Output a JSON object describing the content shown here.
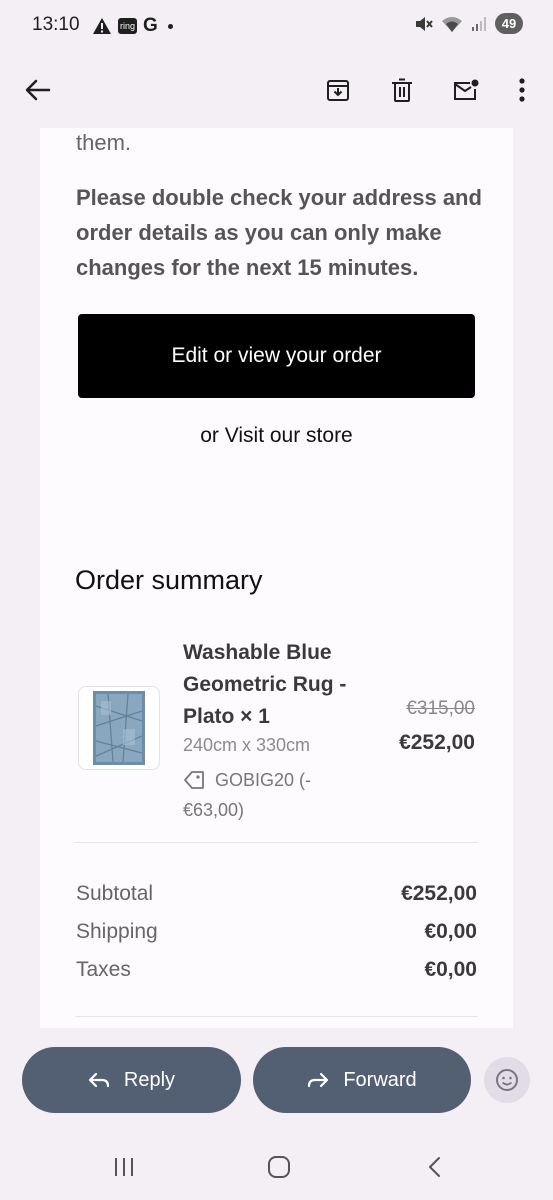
{
  "status_bar": {
    "time": "13:10",
    "notif_ring": "ring",
    "notif_g": "G",
    "battery": "49"
  },
  "app_bar": {
    "icons": [
      "back-arrow-icon",
      "archive-icon",
      "delete-icon",
      "mark-unread-icon",
      "more-vert-icon"
    ]
  },
  "email": {
    "partial_text": "them.",
    "notice": "Please double check your address and order details as you can only make changes for the next 15 minutes.",
    "primary_button": "Edit or view your order",
    "secondary_link": "or Visit our store",
    "summary_title": "Order summary",
    "product": {
      "name": "Washable Blue Geometric Rug - Plato × 1",
      "variant": "240cm x 330cm",
      "discount": "GOBIG20 (-€63,00)",
      "price_original": "€315,00",
      "price_final": "€252,00"
    },
    "totals": [
      {
        "label": "Subtotal",
        "value": "€252,00"
      },
      {
        "label": "Shipping",
        "value": "€0,00"
      },
      {
        "label": "Taxes",
        "value": "€0,00"
      }
    ]
  },
  "actions": {
    "reply": "Reply",
    "forward": "Forward"
  },
  "colors": {
    "background": "#f3eff4",
    "card": "#fdfbfd",
    "primary_button": "#000000",
    "action_pill": "#535f72"
  }
}
